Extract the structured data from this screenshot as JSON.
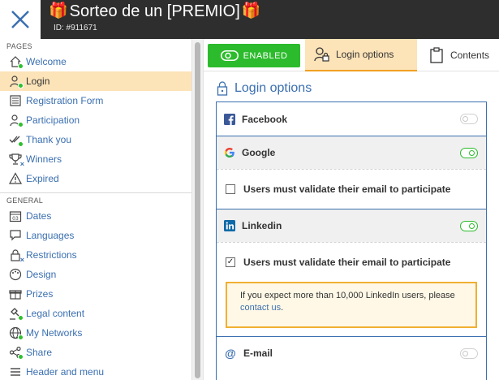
{
  "header": {
    "title": "Sorteo de un [PREMIO]",
    "gift_glyph": "🎁",
    "subtitle": "ID: #911671",
    "close_icon": "close-icon"
  },
  "sidebar": {
    "pages_label": "PAGES",
    "pages": [
      {
        "label": "Welcome",
        "icon": "home-icon",
        "status": "green"
      },
      {
        "label": "Login",
        "icon": "user-lock-icon",
        "status": "green",
        "active": true
      },
      {
        "label": "Registration Form",
        "icon": "form-icon",
        "status": "none"
      },
      {
        "label": "Participation",
        "icon": "participant-icon",
        "status": "green"
      },
      {
        "label": "Thank you",
        "icon": "double-check-icon",
        "status": "green"
      },
      {
        "label": "Winners",
        "icon": "trophy-icon",
        "status": "x"
      },
      {
        "label": "Expired",
        "icon": "warning-icon",
        "status": "none"
      }
    ],
    "general_label": "GENERAL",
    "general": [
      {
        "label": "Dates",
        "icon": "calendar-icon",
        "status": "none"
      },
      {
        "label": "Languages",
        "icon": "speech-bubble-icon",
        "status": "none"
      },
      {
        "label": "Restrictions",
        "icon": "lock-icon",
        "status": "x"
      },
      {
        "label": "Design",
        "icon": "palette-icon",
        "status": "none"
      },
      {
        "label": "Prizes",
        "icon": "gift-icon",
        "status": "none"
      },
      {
        "label": "Legal content",
        "icon": "gavel-icon",
        "status": "green"
      },
      {
        "label": "My Networks",
        "icon": "globe-icon",
        "status": "green"
      },
      {
        "label": "Share",
        "icon": "share-icon",
        "status": "green"
      },
      {
        "label": "Header and menu",
        "icon": "menu-icon",
        "status": "none"
      }
    ]
  },
  "tabs": {
    "enabled_label": "ENABLED",
    "login_label": "Login options",
    "contents_label": "Contents"
  },
  "panel": {
    "title": "Login options",
    "providers": {
      "facebook": {
        "name": "Facebook",
        "enabled": false
      },
      "google": {
        "name": "Google",
        "enabled": true,
        "validate_label": "Users must validate their email to participate",
        "validate_checked": false
      },
      "linkedin": {
        "name": "Linkedin",
        "enabled": true,
        "validate_label": "Users must validate their email to participate",
        "validate_checked": true
      },
      "email": {
        "name": "E-mail",
        "enabled": false
      }
    },
    "notice": {
      "text": "If you expect more than 10,000 LinkedIn users, please",
      "link": "contact us",
      "suffix": "."
    }
  },
  "colors": {
    "accent": "#3a6fb0",
    "enabled_green": "#2cbb2c",
    "active_tab": "#fce3b8",
    "notice_border": "#f0b030",
    "header_bg": "#2e2e2e"
  }
}
